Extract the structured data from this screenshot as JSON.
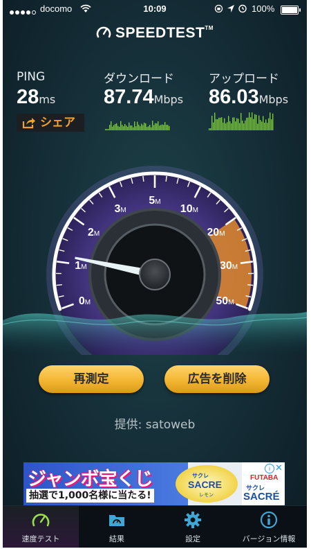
{
  "status_bar": {
    "carrier": "docomo",
    "time": "10:09",
    "battery": "100%"
  },
  "app": {
    "title": "SPEEDTEST",
    "trademark": "TM"
  },
  "results": {
    "ping": {
      "label": "PING",
      "value": "28",
      "unit": "ms"
    },
    "download": {
      "label": "ダウンロード",
      "value": "87.74",
      "unit": "Mbps"
    },
    "upload": {
      "label": "アップロード",
      "value": "86.03",
      "unit": "Mbps"
    },
    "share_label": "シェア"
  },
  "gauge": {
    "scale_labels": [
      "0",
      "1",
      "2",
      "3",
      "5",
      "10",
      "20",
      "30",
      "50"
    ],
    "scale_unit": "M",
    "needle_value_mbps": 0.3
  },
  "buttons": {
    "retest": "再測定",
    "remove_ads": "広告を削除"
  },
  "provider": "提供: satoweb",
  "ad": {
    "headline": "ジャンボ宝くじ",
    "subline": "抽選で1,000名様に当たる!",
    "product_brand": "サクレ",
    "product_name": "SACRE",
    "product_flavor": "レモン",
    "maker": "FUTABA",
    "maker_product_jp": "サクレ",
    "maker_product": "SACRÉ"
  },
  "tabs": [
    {
      "label": "速度テスト",
      "icon": "speedometer-icon",
      "active": true
    },
    {
      "label": "結果",
      "icon": "results-folder-icon",
      "active": false
    },
    {
      "label": "設定",
      "icon": "gear-icon",
      "active": false
    },
    {
      "label": "バージョン情報",
      "icon": "info-icon",
      "active": false
    }
  ],
  "colors": {
    "accent_orange": "#f0a22c",
    "button_gold": "#f3b632",
    "gauge_purple": "#4a3a8a",
    "graph_green": "#7ccb3a"
  }
}
